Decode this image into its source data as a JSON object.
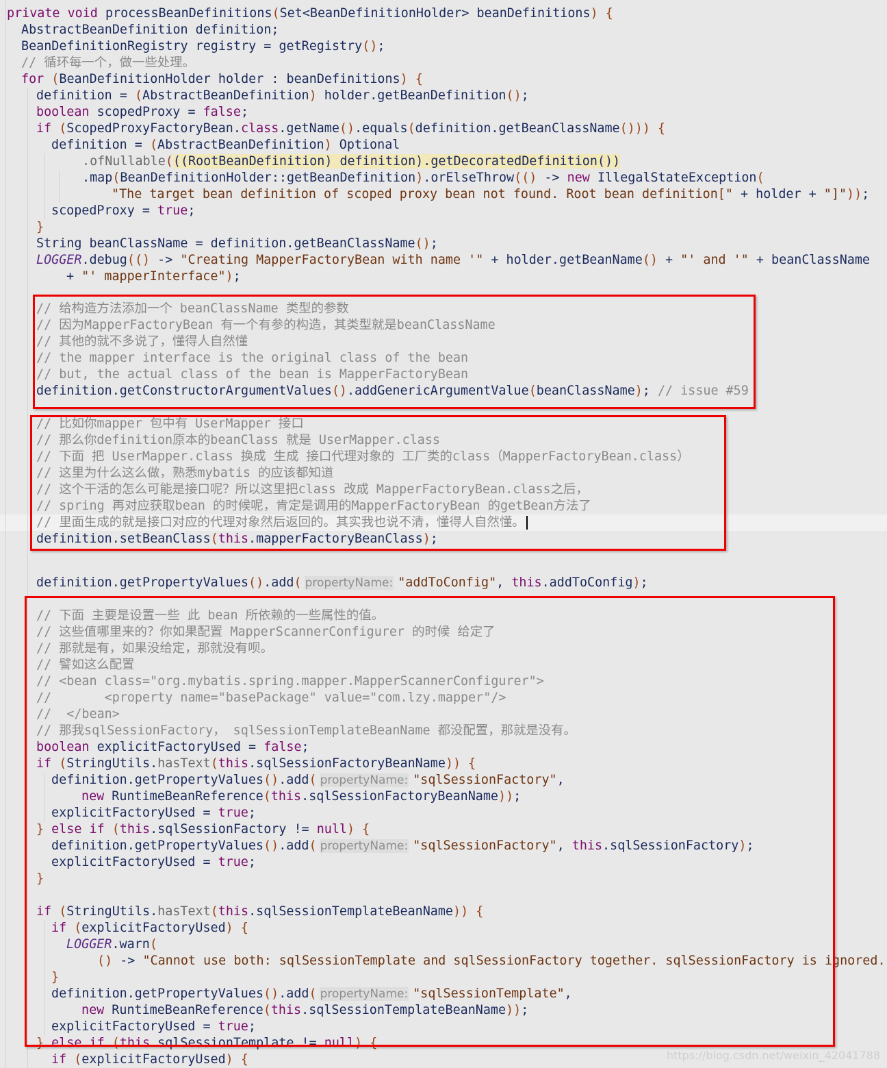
{
  "editor": {
    "language": "java",
    "colors": {
      "background": "#e8e8e8",
      "keyword": "#7b0c6c",
      "identifier": "#1b2a5c",
      "string": "#6e3512",
      "comment": "#8a8a8a",
      "annotation_box": "#ee0000"
    },
    "current_line": 29,
    "lines": [
      [
        [
          "k",
          "private void "
        ],
        [
          "i",
          "processBeanDefinitions"
        ],
        [
          "p",
          "("
        ],
        [
          "i",
          "Set<BeanDefinitionHolder> beanDefinitions"
        ],
        [
          "p",
          ")"
        ],
        [
          "i",
          " "
        ],
        [
          "p",
          "{"
        ]
      ],
      [
        [
          "i",
          "AbstractBeanDefinition definition;"
        ]
      ],
      [
        [
          "i",
          "BeanDefinitionRegistry registry = getRegistry"
        ],
        [
          "p",
          "()"
        ],
        [
          "i",
          ";"
        ]
      ],
      [
        [
          "c",
          "// 循环每一个，做一些处理。"
        ]
      ],
      [
        [
          "k",
          "for "
        ],
        [
          "p",
          "("
        ],
        [
          "i",
          "BeanDefinitionHolder holder : beanDefinitions"
        ],
        [
          "p",
          ")"
        ],
        [
          "i",
          " "
        ],
        [
          "p",
          "{"
        ]
      ],
      [
        [
          "i",
          "definition = "
        ],
        [
          "p",
          "("
        ],
        [
          "i",
          "AbstractBeanDefinition"
        ],
        [
          "p",
          ")"
        ],
        [
          "i",
          " holder.getBeanDefinition"
        ],
        [
          "p",
          "()"
        ],
        [
          "i",
          ";"
        ]
      ],
      [
        [
          "k",
          "boolean "
        ],
        [
          "i",
          "scopedProxy = "
        ],
        [
          "k",
          "false"
        ],
        [
          "i",
          ";"
        ]
      ],
      [
        [
          "k",
          "if "
        ],
        [
          "p",
          "("
        ],
        [
          "i",
          "ScopedProxyFactoryBean."
        ],
        [
          "k",
          "class"
        ],
        [
          "i",
          ".getName"
        ],
        [
          "p",
          "()"
        ],
        [
          "i",
          ".equals"
        ],
        [
          "p",
          "("
        ],
        [
          "i",
          "definition.getBeanClassName"
        ],
        [
          "p",
          "()))"
        ],
        [
          "i",
          " "
        ],
        [
          "p",
          "{"
        ]
      ],
      [
        [
          "i",
          "definition = "
        ],
        [
          "p",
          "("
        ],
        [
          "i",
          "AbstractBeanDefinition"
        ],
        [
          "p",
          ")"
        ],
        [
          "i",
          " Optional"
        ]
      ],
      [
        [
          "g",
          ".ofNullable"
        ],
        [
          "p",
          "("
        ],
        [
          "y",
          "((RootBeanDefinition) definition).getDecoratedDefinition())"
        ]
      ],
      [
        [
          "i",
          ".map"
        ],
        [
          "p",
          "("
        ],
        [
          "i",
          "BeanDefinitionHolder::getBeanDefinition"
        ],
        [
          "p",
          ")"
        ],
        [
          "i",
          ".orElseThrow"
        ],
        [
          "p",
          "(()"
        ],
        [
          "i",
          " -> "
        ],
        [
          "k",
          "new "
        ],
        [
          "i",
          "IllegalStateException"
        ],
        [
          "p",
          "("
        ]
      ],
      [
        [
          "s",
          "\"The target bean definition of scoped proxy bean not found. Root bean definition[\""
        ],
        [
          "i",
          " + holder + "
        ],
        [
          "s",
          "\"]\""
        ],
        [
          "p",
          "))"
        ],
        [
          "i",
          ";"
        ]
      ],
      [
        [
          "i",
          "scopedProxy = "
        ],
        [
          "k",
          "true"
        ],
        [
          "i",
          ";"
        ]
      ],
      [
        [
          "p",
          "}"
        ]
      ],
      [
        [
          "i",
          "String beanClassName = definition.getBeanClassName"
        ],
        [
          "p",
          "()"
        ],
        [
          "i",
          ";"
        ]
      ],
      [
        [
          "l",
          "LOGGER"
        ],
        [
          "i",
          ".debug"
        ],
        [
          "p",
          "(()"
        ],
        [
          "i",
          " -> "
        ],
        [
          "s",
          "\"Creating MapperFactoryBean with name '\""
        ],
        [
          "i",
          " + holder.getBeanName"
        ],
        [
          "p",
          "()"
        ],
        [
          "i",
          " + "
        ],
        [
          "s",
          "\"' and '\""
        ],
        [
          "i",
          " + beanClassName"
        ]
      ],
      [
        [
          "i",
          "+ "
        ],
        [
          "s",
          "\"' mapperInterface\""
        ],
        [
          "p",
          ")"
        ],
        [
          "i",
          ";"
        ]
      ],
      [
        [
          "c",
          "// 给构造方法添加一个 beanClassName 类型的参数"
        ]
      ],
      [
        [
          "c",
          "// 因为MapperFactoryBean 有一个有参的构造，其类型就是beanClassName"
        ]
      ],
      [
        [
          "c",
          "// 其他的就不多说了，懂得人自然懂"
        ]
      ],
      [
        [
          "c",
          "// the mapper interface is the original class of the bean"
        ]
      ],
      [
        [
          "c",
          "// but, the actual class of the bean is MapperFactoryBean"
        ]
      ],
      [
        [
          "i",
          "definition.getConstructorArgumentValues"
        ],
        [
          "p",
          "()"
        ],
        [
          "i",
          ".addGenericArgumentValue"
        ],
        [
          "p",
          "("
        ],
        [
          "i",
          "beanClassName"
        ],
        [
          "p",
          ")"
        ],
        [
          "i",
          "; "
        ],
        [
          "c",
          "// issue #59"
        ]
      ],
      [
        [
          "c",
          "// 比如你mapper 包中有 UserMapper 接口"
        ]
      ],
      [
        [
          "c",
          "// 那么你definition原本的beanClass 就是 UserMapper.class"
        ]
      ],
      [
        [
          "c",
          "// 下面 把 UserMapper.class 换成 生成 接口代理对象的 工厂类的class（MapperFactoryBean.class）"
        ]
      ],
      [
        [
          "c",
          "// 这里为什么这么做，熟悉mybatis 的应该都知道"
        ]
      ],
      [
        [
          "c",
          "// 这个干活的怎么可能是接口呢？所以这里把class 改成 MapperFactoryBean.class之后，"
        ]
      ],
      [
        [
          "c",
          "// spring 再对应获取bean 的时候呢，肯定是调用的MapperFactoryBean 的getBean方法了"
        ]
      ],
      [
        [
          "c",
          "// 里面生成的就是接口对应的代理对象然后返回的。其实我也说不清，懂得人自然懂。"
        ]
      ],
      [
        [
          "i",
          "definition.setBeanClass"
        ],
        [
          "p",
          "("
        ],
        [
          "k",
          "this"
        ],
        [
          "i",
          ".mapperFactoryBeanClass"
        ],
        [
          "p",
          ")"
        ],
        [
          "i",
          ";"
        ]
      ],
      [
        [
          "i",
          "definition.getPropertyValues"
        ],
        [
          "p",
          "()"
        ],
        [
          "i",
          ".add"
        ],
        [
          "p",
          "("
        ],
        [
          "h",
          "propertyName:"
        ],
        [
          "s",
          "\"addToConfig\""
        ],
        [
          "i",
          ", "
        ],
        [
          "k",
          "this"
        ],
        [
          "i",
          ".addToConfig"
        ],
        [
          "p",
          ")"
        ],
        [
          "i",
          ";"
        ]
      ],
      [
        [
          "c",
          "// 下面 主要是设置一些 此 bean 所依赖的一些属性的值。"
        ]
      ],
      [
        [
          "c",
          "// 这些值哪里来的？你如果配置 MapperScannerConfigurer 的时候 给定了"
        ]
      ],
      [
        [
          "c",
          "// 那就是有，如果没给定，那就没有呗。"
        ]
      ],
      [
        [
          "c",
          "// 譬如这么配置"
        ]
      ],
      [
        [
          "c",
          "// <bean class=\"org.mybatis.spring.mapper.MapperScannerConfigurer\">"
        ]
      ],
      [
        [
          "c",
          "//       <property name=\"basePackage\" value=\"com.lzy.mapper\"/>"
        ]
      ],
      [
        [
          "c",
          "//  </bean>"
        ]
      ],
      [
        [
          "c",
          "// 那我sqlSessionFactory， sqlSessionTemplateBeanName 都没配置，那就是没有。"
        ]
      ],
      [
        [
          "k",
          "boolean "
        ],
        [
          "i",
          "explicitFactoryUsed = "
        ],
        [
          "k",
          "false"
        ],
        [
          "i",
          ";"
        ]
      ],
      [
        [
          "k",
          "if "
        ],
        [
          "p",
          "("
        ],
        [
          "i",
          "StringUtils."
        ],
        [
          "g",
          "hasText"
        ],
        [
          "p",
          "("
        ],
        [
          "k",
          "this"
        ],
        [
          "i",
          ".sqlSessionFactoryBeanName"
        ],
        [
          "p",
          "))"
        ],
        [
          "i",
          " "
        ],
        [
          "p",
          "{"
        ]
      ],
      [
        [
          "i",
          "definition.getPropertyValues"
        ],
        [
          "p",
          "()"
        ],
        [
          "i",
          ".add"
        ],
        [
          "p",
          "("
        ],
        [
          "h",
          "propertyName:"
        ],
        [
          "s",
          "\"sqlSessionFactory\""
        ],
        [
          "i",
          ","
        ]
      ],
      [
        [
          "k",
          "new "
        ],
        [
          "i",
          "RuntimeBeanReference"
        ],
        [
          "p",
          "("
        ],
        [
          "k",
          "this"
        ],
        [
          "i",
          ".sqlSessionFactoryBeanName"
        ],
        [
          "p",
          "))"
        ],
        [
          "i",
          ";"
        ]
      ],
      [
        [
          "i",
          "explicitFactoryUsed = "
        ],
        [
          "k",
          "true"
        ],
        [
          "i",
          ";"
        ]
      ],
      [
        [
          "p",
          "}"
        ],
        [
          "k",
          " else if "
        ],
        [
          "p",
          "("
        ],
        [
          "k",
          "this"
        ],
        [
          "i",
          ".sqlSessionFactory != "
        ],
        [
          "k",
          "null"
        ],
        [
          "p",
          ")"
        ],
        [
          "i",
          " "
        ],
        [
          "p",
          "{"
        ]
      ],
      [
        [
          "i",
          "definition.getPropertyValues"
        ],
        [
          "p",
          "()"
        ],
        [
          "i",
          ".add"
        ],
        [
          "p",
          "("
        ],
        [
          "h",
          "propertyName:"
        ],
        [
          "s",
          "\"sqlSessionFactory\""
        ],
        [
          "i",
          ", "
        ],
        [
          "k",
          "this"
        ],
        [
          "i",
          ".sqlSessionFactory"
        ],
        [
          "p",
          ")"
        ],
        [
          "i",
          ";"
        ]
      ],
      [
        [
          "i",
          "explicitFactoryUsed = "
        ],
        [
          "k",
          "true"
        ],
        [
          "i",
          ";"
        ]
      ],
      [
        [
          "p",
          "}"
        ]
      ],
      [
        [
          "k",
          "if "
        ],
        [
          "p",
          "("
        ],
        [
          "i",
          "StringUtils."
        ],
        [
          "g",
          "hasText"
        ],
        [
          "p",
          "("
        ],
        [
          "k",
          "this"
        ],
        [
          "i",
          ".sqlSessionTemplateBeanName"
        ],
        [
          "p",
          "))"
        ],
        [
          "i",
          " "
        ],
        [
          "p",
          "{"
        ]
      ],
      [
        [
          "k",
          "if "
        ],
        [
          "p",
          "("
        ],
        [
          "i",
          "explicitFactoryUsed"
        ],
        [
          "p",
          ")"
        ],
        [
          "i",
          " "
        ],
        [
          "p",
          "{"
        ]
      ],
      [
        [
          "l",
          "LOGGER"
        ],
        [
          "i",
          ".warn"
        ],
        [
          "p",
          "("
        ]
      ],
      [
        [
          "p",
          "()"
        ],
        [
          "i",
          " -> "
        ],
        [
          "s",
          "\"Cannot use both: sqlSessionTemplate and sqlSessionFactory together. sqlSessionFactory is ignored.\""
        ]
      ],
      [
        [
          "p",
          "}"
        ]
      ],
      [
        [
          "i",
          "definition.getPropertyValues"
        ],
        [
          "p",
          "()"
        ],
        [
          "i",
          ".add"
        ],
        [
          "p",
          "("
        ],
        [
          "h",
          "propertyName:"
        ],
        [
          "s",
          "\"sqlSessionTemplate\""
        ],
        [
          "i",
          ","
        ]
      ],
      [
        [
          "k",
          "new "
        ],
        [
          "i",
          "RuntimeBeanReference"
        ],
        [
          "p",
          "("
        ],
        [
          "k",
          "this"
        ],
        [
          "i",
          ".sqlSessionTemplateBeanName"
        ],
        [
          "p",
          "))"
        ],
        [
          "i",
          ";"
        ]
      ],
      [
        [
          "i",
          "explicitFactoryUsed = "
        ],
        [
          "k",
          "true"
        ],
        [
          "i",
          ";"
        ]
      ],
      [
        [
          "p",
          "}"
        ],
        [
          "k",
          " else if "
        ],
        [
          "p",
          "("
        ],
        [
          "k",
          "this"
        ],
        [
          "i",
          ".sqlSessionTemplate != "
        ],
        [
          "k",
          "null"
        ],
        [
          "p",
          ")"
        ],
        [
          "i",
          " "
        ],
        [
          "p",
          "{"
        ]
      ],
      [
        [
          "k",
          "if "
        ],
        [
          "p",
          "("
        ],
        [
          "i",
          "explicitFactoryUsed"
        ],
        [
          "p",
          ")"
        ],
        [
          "i",
          " "
        ],
        [
          "p",
          "{"
        ]
      ]
    ]
  },
  "watermark": "https://blog.csdn.net/weixin_42041788"
}
